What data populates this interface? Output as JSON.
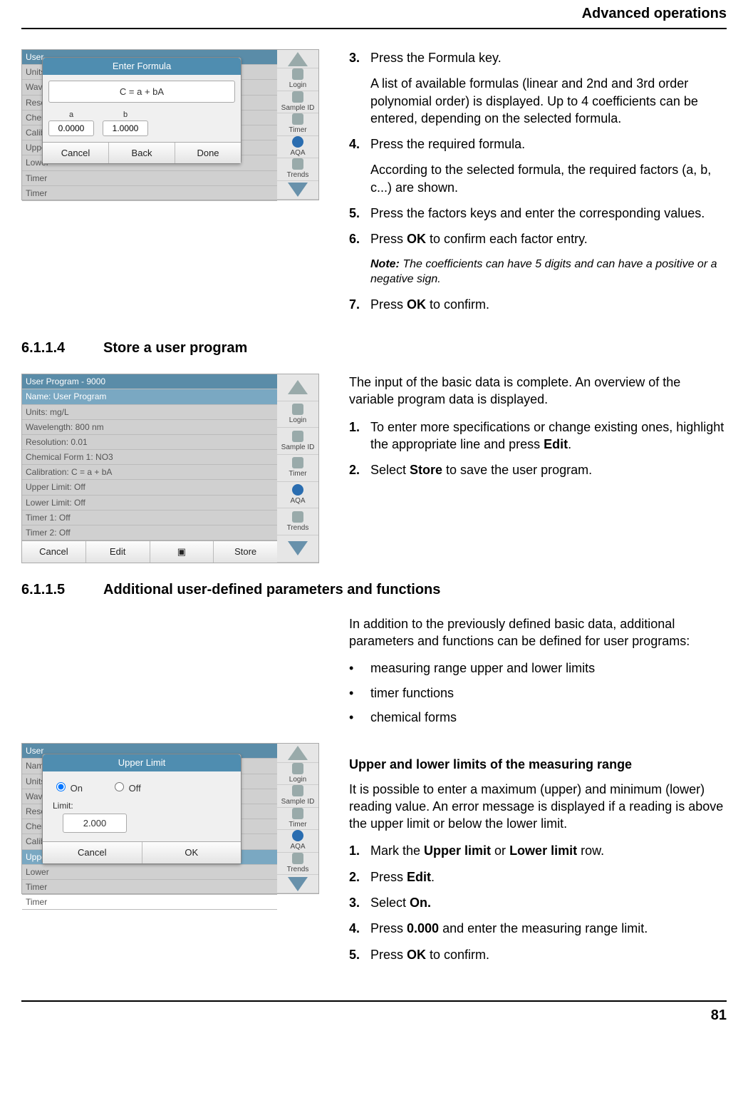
{
  "running_head": "Advanced operations",
  "page_number": "81",
  "sideicons": {
    "login": "Login",
    "sampleid": "Sample ID",
    "timer": "Timer",
    "aqa": "AQA",
    "trends": "Trends"
  },
  "fig1": {
    "bg_rows": [
      "User",
      "Units:",
      "Wavel",
      "Resolu",
      "Chemi",
      "Calibra",
      "Upper",
      "Lower",
      "Timer ",
      "Timer "
    ],
    "dlg_title": "Enter Formula",
    "formula": "C = a + bA",
    "coef_a_label": "a",
    "coef_a_value": "0.0000",
    "coef_b_label": "b",
    "coef_b_value": "1.0000",
    "btn_cancel": "Cancel",
    "btn_back": "Back",
    "btn_done": "Done"
  },
  "block1": {
    "s3": "Press the Formula key.",
    "s3_after": "A list of available formulas (linear and 2nd and 3rd order polynomial order) is displayed. Up to 4 coefficients can be entered, depending on the selected formula.",
    "s4": "Press the required formula.",
    "s4_after": "According to the selected formula, the required factors (a, b, c...) are shown.",
    "s5": "Press the factors keys and enter the corresponding values.",
    "s6_pre": "Press ",
    "s6_bold": "OK",
    "s6_post": " to confirm each factor entry.",
    "note_label": "Note:",
    "note_body": " The coefficients can have 5 digits and can have a positive or a negative sign.",
    "s7_pre": "Press ",
    "s7_bold": "OK",
    "s7_post": " to confirm."
  },
  "sec_6114_num": "6.1.1.4",
  "sec_6114_title": "Store a user program",
  "fig2": {
    "title": "User Program - 9000",
    "rows": [
      "Name: User Program",
      "Units: mg/L",
      "Wavelength: 800 nm",
      "Resolution: 0.01",
      "Chemical Form 1: NO3",
      "Calibration: C = a + bA",
      "Upper Limit: Off",
      "Lower Limit: Off",
      "Timer 1: Off",
      "Timer 2: Off"
    ],
    "btn_cancel": "Cancel",
    "btn_edit": "Edit",
    "btn_store": "Store"
  },
  "block2": {
    "intro": "The input of the basic data is complete. An overview of the variable program data is displayed.",
    "s1_pre": "To enter more specifications or change existing ones, highlight the appropriate line and press ",
    "s1_bold": "Edit",
    "s1_post": ".",
    "s2_pre": "Select ",
    "s2_bold": "Store",
    "s2_post": " to save the user program."
  },
  "sec_6115_num": "6.1.1.5",
  "sec_6115_title": "Additional user-defined parameters and functions",
  "block3": {
    "intro": "In addition to the previously defined basic data, additional parameters and functions can be defined for user programs:",
    "b1": "measuring range upper and lower limits",
    "b2": "timer functions",
    "b3": "chemical forms"
  },
  "fig3": {
    "bg_rows": [
      "User",
      "Name:",
      "Units:",
      "Wavel",
      "Resolu",
      "Chemi",
      "Calibra",
      "Upper",
      "Lower",
      "Timer ",
      "Timer "
    ],
    "dlg_title": "Upper Limit",
    "on_label": "On",
    "off_label": "Off",
    "limit_label": "Limit:",
    "limit_value": "2.000",
    "btn_cancel": "Cancel",
    "btn_ok": "OK"
  },
  "block4": {
    "subhead": "Upper and lower limits of the measuring range",
    "intro": "It is possible to enter a maximum (upper) and minimum (lower) reading value. An error message is displayed if a reading is above the upper limit or below the lower limit.",
    "s1_pre": "Mark the ",
    "s1_b1": "Upper limit",
    "s1_mid": " or ",
    "s1_b2": "Lower limit",
    "s1_post": " row.",
    "s2_pre": "Press ",
    "s2_bold": "Edit",
    "s2_post": ".",
    "s3_pre": "Select ",
    "s3_bold": "On.",
    "s4_pre": "Press ",
    "s4_bold": "0.000",
    "s4_post": " and enter the measuring range limit.",
    "s5_pre": "Press ",
    "s5_bold": "OK",
    "s5_post": " to confirm."
  }
}
